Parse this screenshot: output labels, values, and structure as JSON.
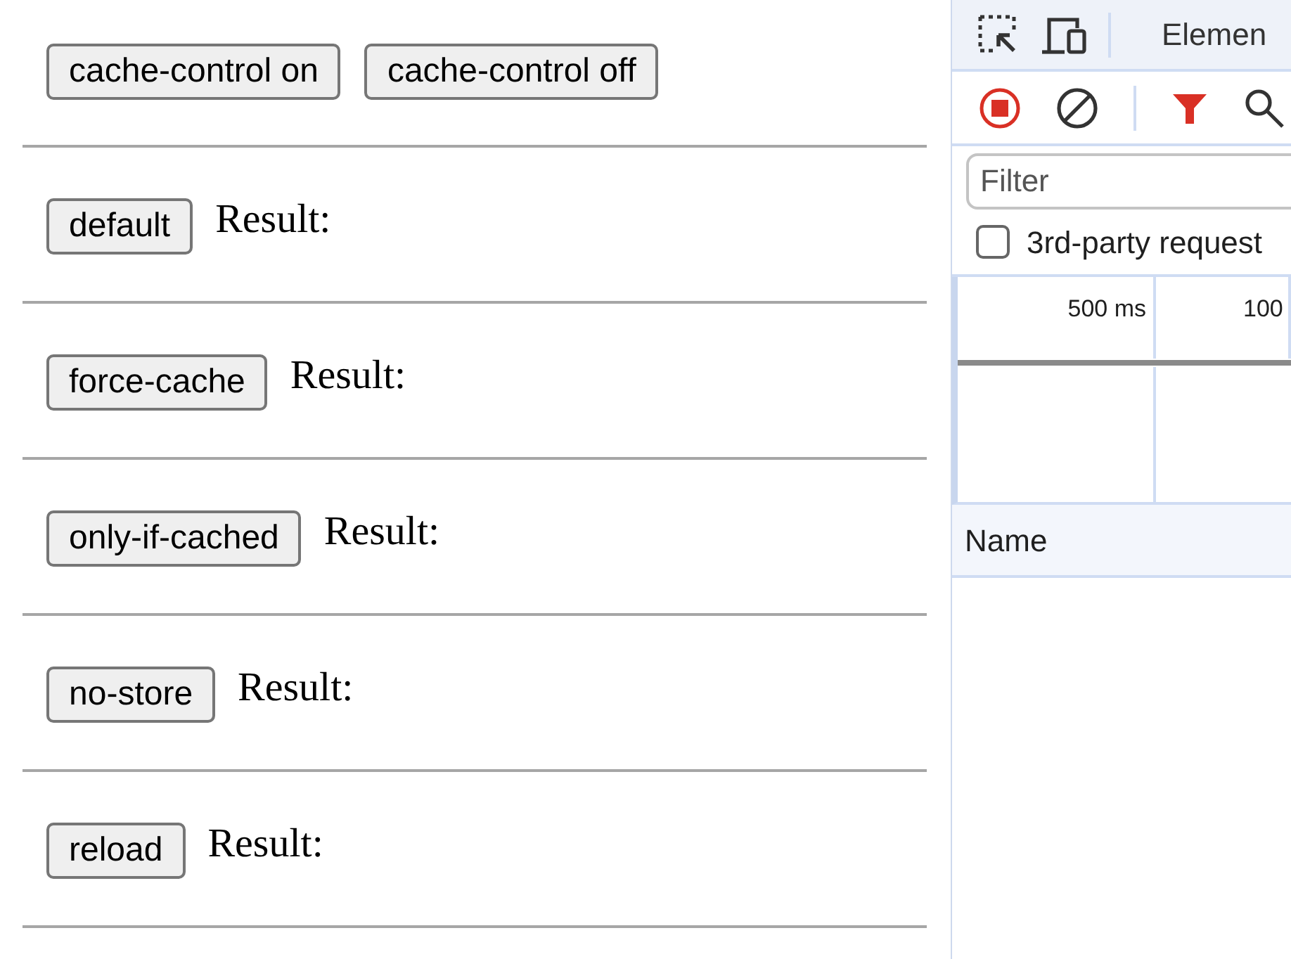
{
  "page": {
    "top_buttons": [
      "cache-control on",
      "cache-control off"
    ],
    "sections": [
      {
        "button": "default",
        "result": "Result:"
      },
      {
        "button": "force-cache",
        "result": "Result:"
      },
      {
        "button": "only-if-cached",
        "result": "Result:"
      },
      {
        "button": "no-store",
        "result": "Result:"
      },
      {
        "button": "reload",
        "result": "Result:"
      }
    ]
  },
  "devtools": {
    "tabs": [
      {
        "label": "Elemen",
        "selected": false
      }
    ],
    "recording": true,
    "filter_active": true,
    "filter": {
      "placeholder": "Filter"
    },
    "third_party": {
      "label": "3rd-party request",
      "checked": false
    },
    "timeline_ticks": [
      "500 ms",
      "100"
    ],
    "columns": [
      "Name"
    ]
  }
}
